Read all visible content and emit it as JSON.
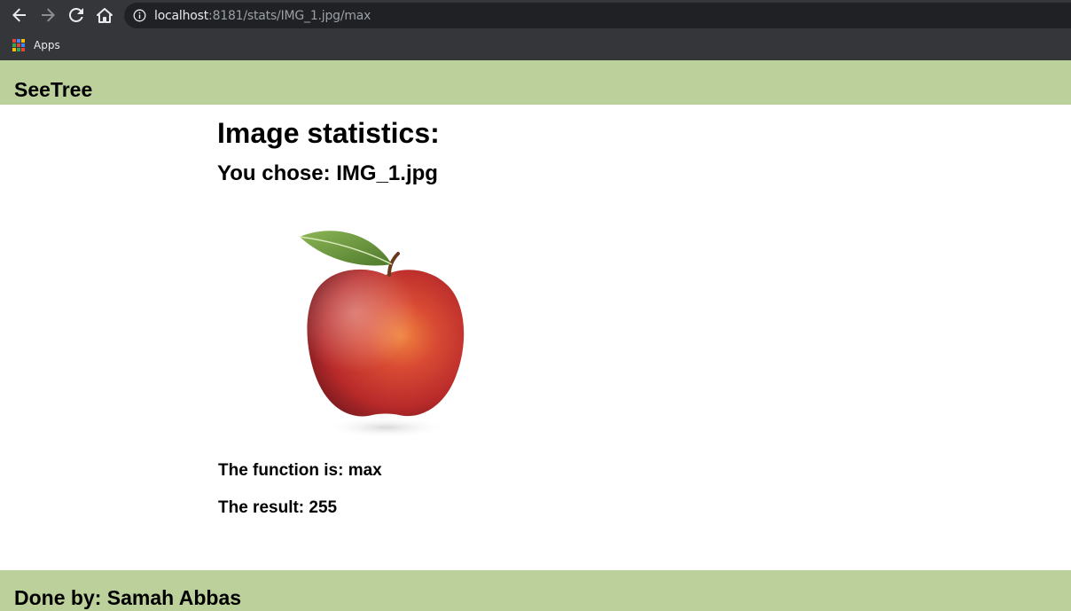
{
  "browser": {
    "url_host": "localhost",
    "url_path": ":8181/stats/IMG_1.jpg/max",
    "bookmarks": {
      "apps_label": "Apps"
    },
    "icons": [
      "back-icon",
      "forward-icon",
      "reload-icon",
      "home-icon",
      "info-icon",
      "apps-grid-icon"
    ]
  },
  "header": {
    "brand": "SeeTree"
  },
  "main": {
    "title": "Image statistics:",
    "chosen_prefix": "You chose: ",
    "chosen_file": "IMG_1.jpg",
    "function_prefix": "The function is: ",
    "function_name": "max",
    "result_prefix": "The result: ",
    "result_value": "255"
  },
  "footer": {
    "credit_prefix": "Done by: ",
    "credit_name": "Samah Abbas"
  },
  "colors": {
    "header_bg": "#bbd09a",
    "footer_bg": "#bbd09a",
    "chrome_bg": "#35363a",
    "omnibox_bg": "#202124"
  }
}
